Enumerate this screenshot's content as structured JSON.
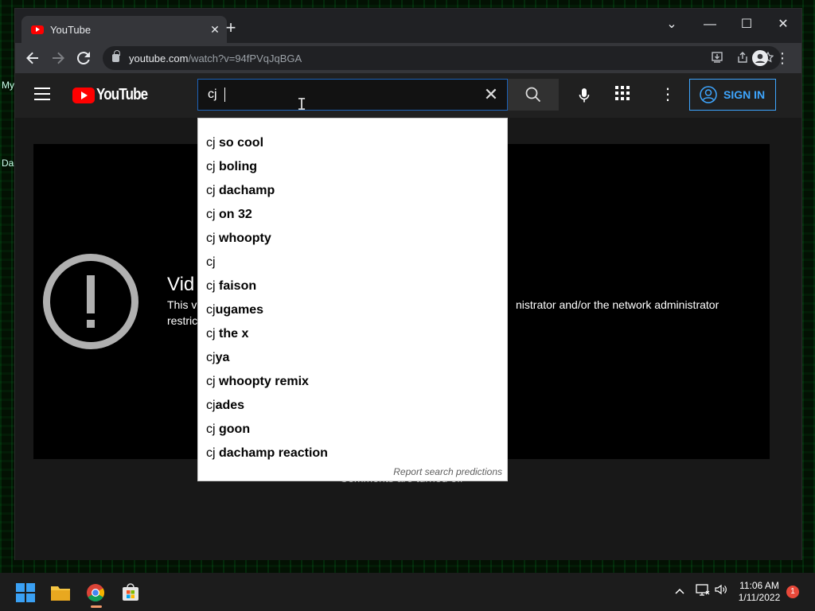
{
  "desktop": {
    "labels": [
      "My",
      "Da"
    ]
  },
  "browser": {
    "tab": {
      "title": "YouTube",
      "close": "✕"
    },
    "new_tab": "+",
    "window_controls": {
      "dropdown": "⌄",
      "minimize": "—",
      "maximize": "☐",
      "close": "✕"
    },
    "url": {
      "host": "youtube.com",
      "path": "/watch?v=94fPVqJqBGA"
    }
  },
  "youtube": {
    "logo_text": "YouTube",
    "search": {
      "value": "cj",
      "placeholder": "Search"
    },
    "sign_in": "SIGN IN",
    "suggestions": [
      {
        "typed": "cj",
        "rest": " so cool"
      },
      {
        "typed": "cj",
        "rest": " boling"
      },
      {
        "typed": "cj",
        "rest": " dachamp"
      },
      {
        "typed": "cj",
        "rest": " on 32"
      },
      {
        "typed": "cj",
        "rest": " whoopty"
      },
      {
        "typed": "cj",
        "rest": ""
      },
      {
        "typed": "cj",
        "rest": " faison"
      },
      {
        "typed": "cj",
        "rest": "ugames"
      },
      {
        "typed": "cj",
        "rest": " the x"
      },
      {
        "typed": "cj",
        "rest": "ya"
      },
      {
        "typed": "cj",
        "rest": " whoopty remix"
      },
      {
        "typed": "cj",
        "rest": "ades"
      },
      {
        "typed": "cj",
        "rest": " goon"
      },
      {
        "typed": "cj",
        "rest": " dachamp reaction"
      }
    ],
    "report_link": "Report search predictions",
    "error": {
      "title": "Vid",
      "line1_start": "This v",
      "line1_end": "nistrator and/or the network administrator",
      "line2_start": "restric"
    },
    "comments_note": "Comments are turned off"
  },
  "taskbar": {
    "time": "11:06 AM",
    "date": "1/11/2022",
    "notification_count": "1"
  },
  "colors": {
    "youtube_red": "#ff0000",
    "sign_in_blue": "#3ea6ff",
    "search_focus_border": "#1c62b9"
  }
}
